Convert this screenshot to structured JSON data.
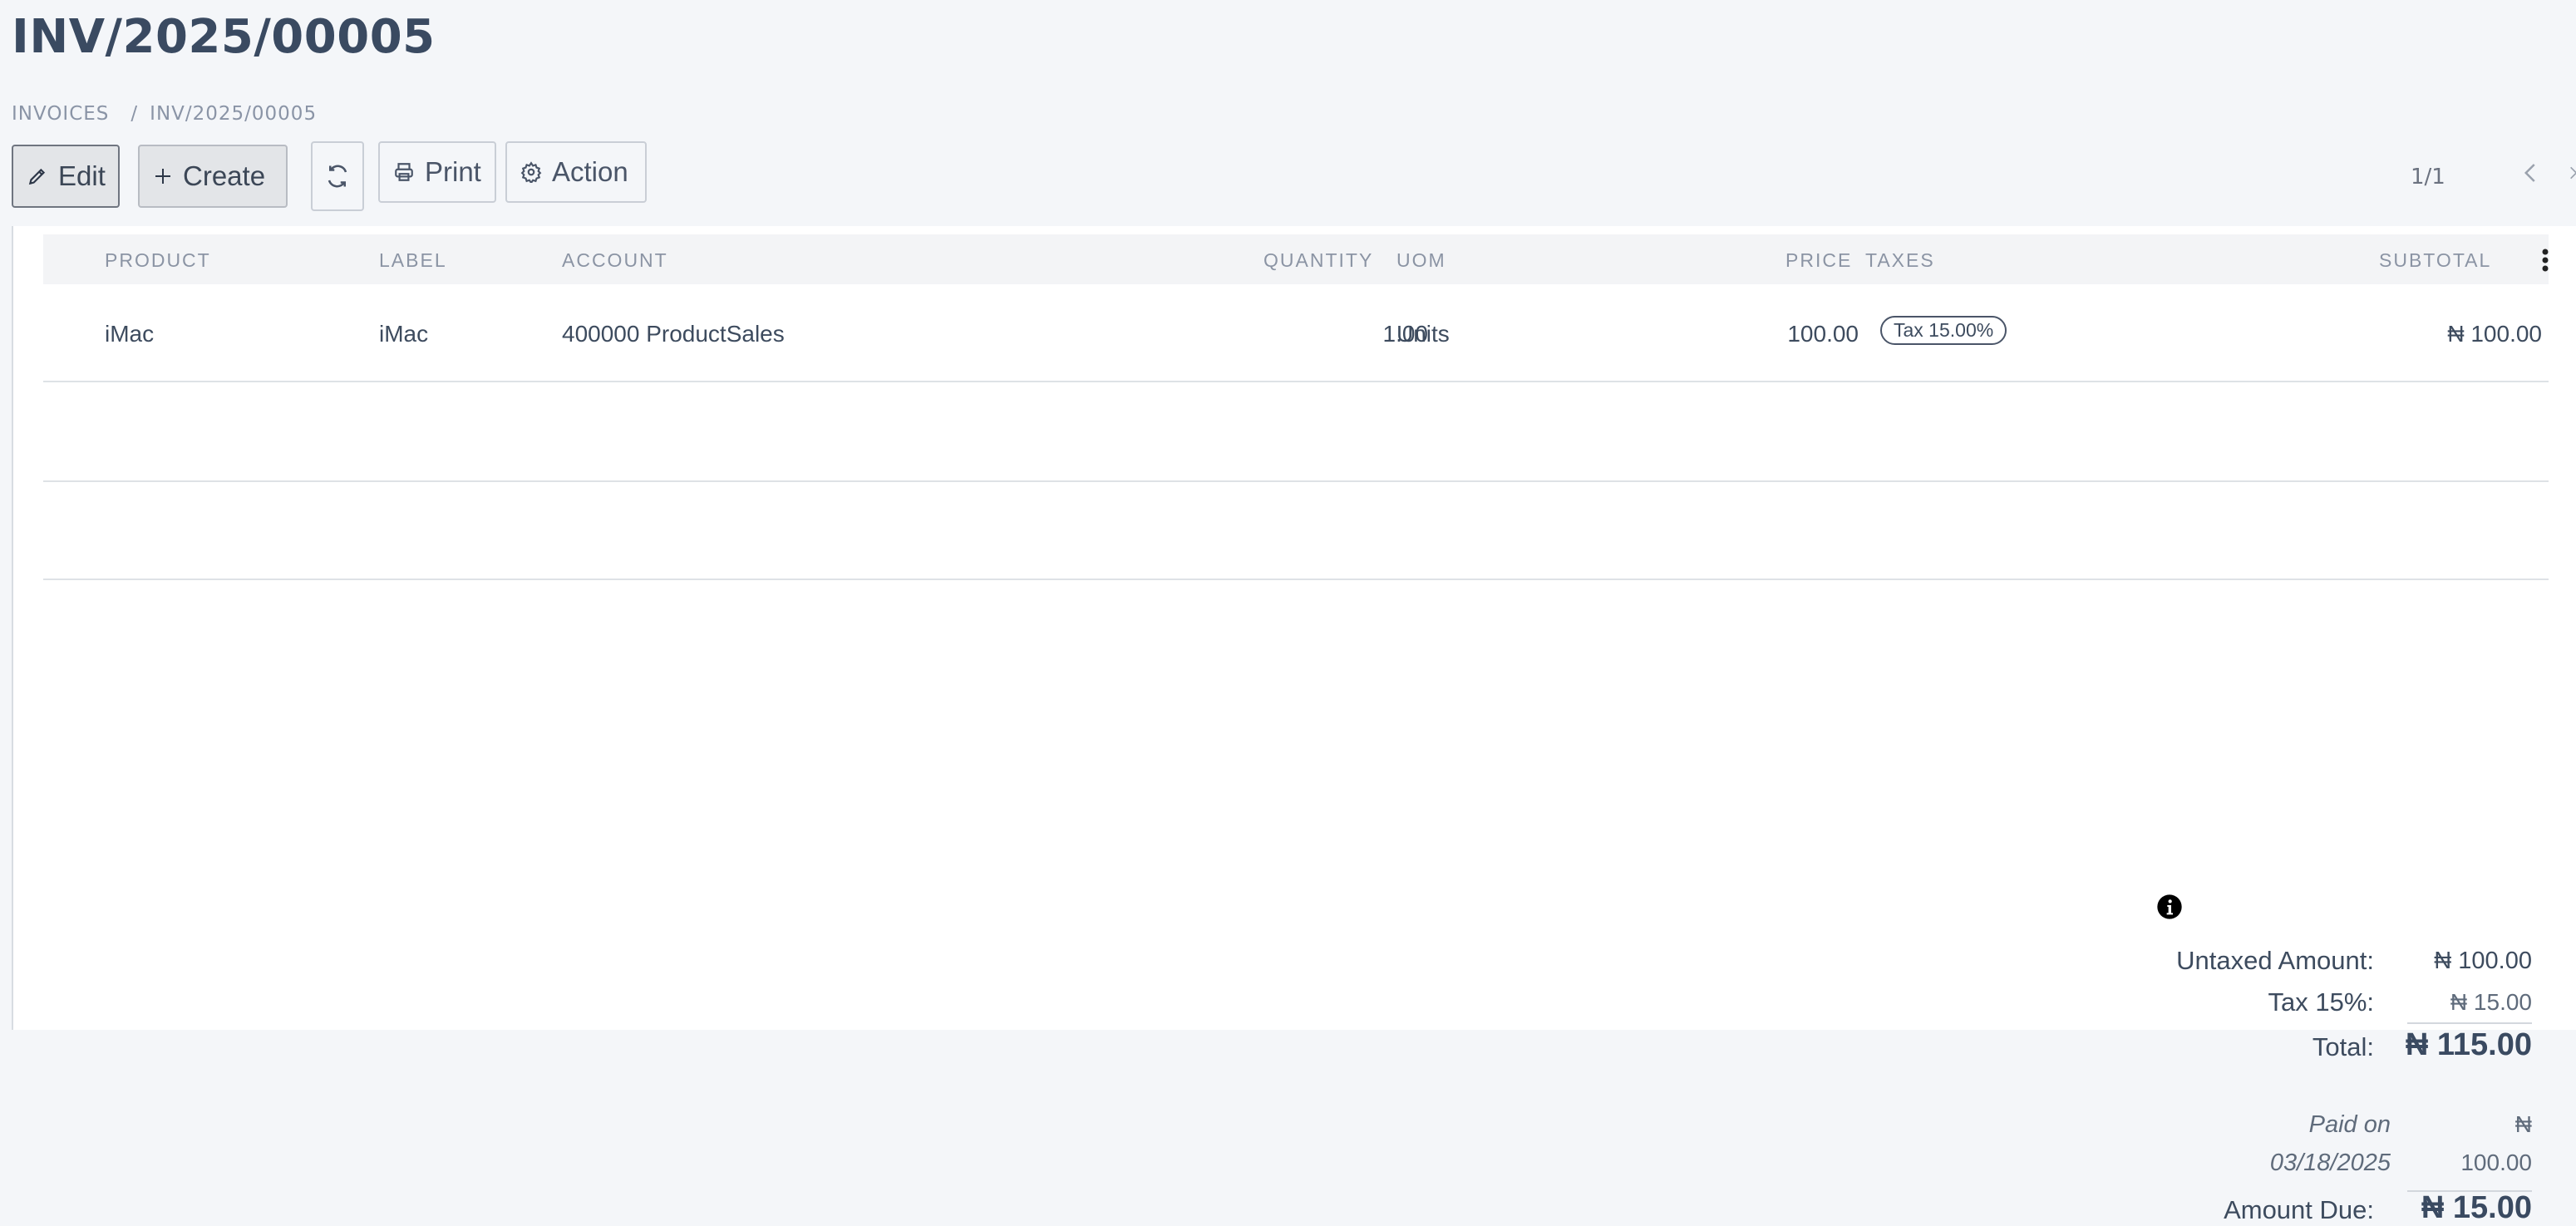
{
  "header": {
    "title": "INV/2025/00005",
    "breadcrumb": [
      "INVOICES",
      "INV/2025/00005"
    ]
  },
  "toolbar": {
    "edit_label": "Edit",
    "create_label": "Create",
    "print_label": "Print",
    "action_label": "Action"
  },
  "pager": {
    "text": "1/1"
  },
  "table": {
    "columns": [
      "PRODUCT",
      "LABEL",
      "ACCOUNT",
      "QUANTITY",
      "UOM",
      "PRICE",
      "TAXES",
      "SUBTOTAL"
    ],
    "rows": [
      {
        "product": "iMac",
        "label": "iMac",
        "account": "400000 ProductSales",
        "quantity": "1.00",
        "uom": "Units",
        "price": "100.00",
        "taxes": "Tax 15.00%",
        "subtotal": "₦ 100.00"
      }
    ]
  },
  "totals": {
    "untaxed_label": "Untaxed Amount:",
    "untaxed_value": "₦ 100.00",
    "tax_label": "Tax 15%:",
    "tax_value": "₦ 15.00",
    "total_label": "Total:",
    "total_value": "₦ 115.00",
    "paid_line1": "Paid on",
    "paid_line2": "03/18/2025",
    "paid_currency": "₦",
    "paid_amount": "100.00",
    "due_label": "Amount Due:",
    "due_value": "₦ 15.00"
  },
  "colors": {
    "background": "#f4f6f9",
    "sheet": "#ffffff",
    "title": "#3a4a61"
  }
}
